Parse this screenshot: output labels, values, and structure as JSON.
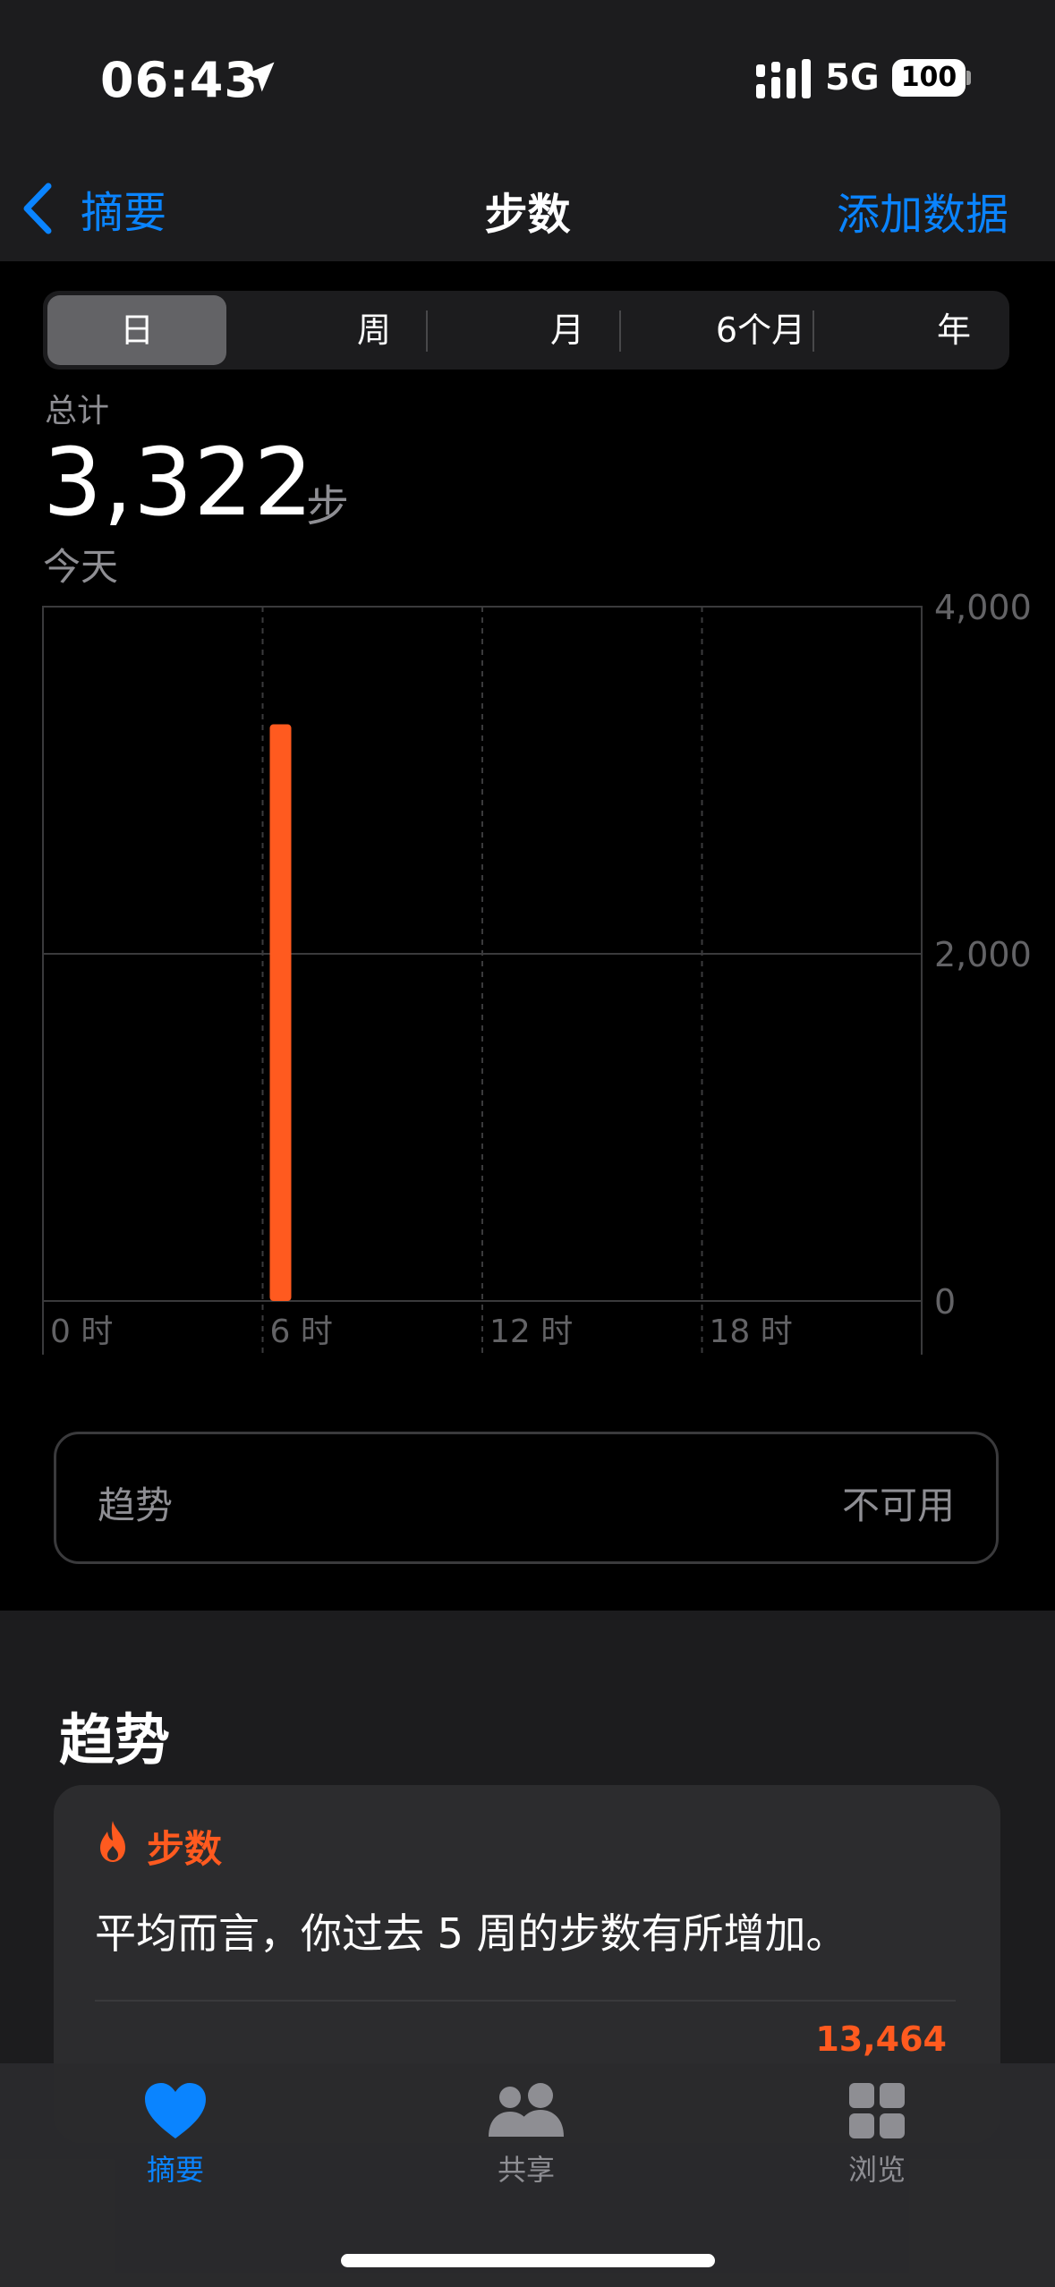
{
  "status_bar": {
    "time": "06:43",
    "network": "5G",
    "battery": "100"
  },
  "nav": {
    "back_label": "摘要",
    "title": "步数",
    "action_label": "添加数据"
  },
  "segments": {
    "day": "日",
    "week": "周",
    "month": "月",
    "six_months": "6个月",
    "year": "年",
    "selected": "日"
  },
  "summary": {
    "label": "总计",
    "value": "3,322",
    "unit": "步",
    "date": "今天"
  },
  "chart_data": {
    "type": "bar",
    "x_ticks": [
      "0 时",
      "6 时",
      "12 时",
      "18 时"
    ],
    "y_ticks": [
      "0",
      "2,000",
      "4,000"
    ],
    "ylim": [
      0,
      4000
    ],
    "xlim": [
      0,
      24
    ],
    "bars": [
      {
        "hour": 6,
        "value": 3322
      }
    ],
    "bar_color": "#ff5a1f",
    "grid": true
  },
  "trend_card": {
    "label": "趋势",
    "value": "不可用"
  },
  "trends": {
    "section_title": "趋势",
    "metric": "步数",
    "text": "平均而言，你过去 5 周的步数有所增加。",
    "value": "13,464"
  },
  "tabbar": {
    "summary": "摘要",
    "sharing": "共享",
    "browse": "浏览",
    "active": "summary"
  },
  "colors": {
    "accent": "#0a84ff",
    "steps": "#ff5a1f",
    "background": "#000000"
  }
}
